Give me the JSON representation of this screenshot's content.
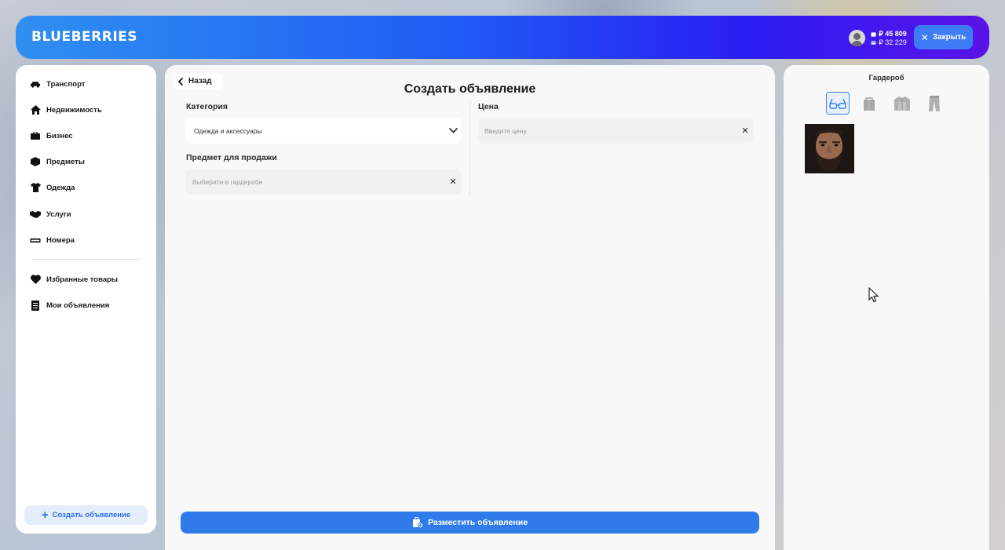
{
  "header": {
    "logo": "BLUEBERRIES",
    "balance_cash": "₽ 45 809",
    "balance_bank": "₽ 32 229",
    "close_label": "Закрыть"
  },
  "sidebar": {
    "items": [
      {
        "label": "Транспорт",
        "icon": "car-icon"
      },
      {
        "label": "Недвижимость",
        "icon": "house-icon"
      },
      {
        "label": "Бизнес",
        "icon": "briefcase-icon"
      },
      {
        "label": "Предметы",
        "icon": "box-icon"
      },
      {
        "label": "Одежда",
        "icon": "shirt-icon"
      },
      {
        "label": "Услуги",
        "icon": "handshake-icon"
      },
      {
        "label": "Номера",
        "icon": "license-plate-icon"
      }
    ],
    "extra": [
      {
        "label": "Избранные товары",
        "icon": "heart-icon"
      },
      {
        "label": "Мои объявления",
        "icon": "document-icon"
      }
    ],
    "create_label": "Создать объявление"
  },
  "main": {
    "back_label": "Назад",
    "title": "Создать объявление",
    "category_label": "Категория",
    "category_value": "Одежда и аксессуары",
    "item_label": "Предмет для продажи",
    "item_placeholder": "Выберите в гардеробе",
    "price_label": "Цена",
    "price_placeholder": "Введите цену",
    "submit_label": "Разместить объявление"
  },
  "wardrobe": {
    "title": "Гардероб",
    "tabs": [
      "glasses-icon",
      "bag-icon",
      "jacket-icon",
      "pants-icon"
    ],
    "active_tab": 0,
    "accent": "#3a86f0"
  }
}
